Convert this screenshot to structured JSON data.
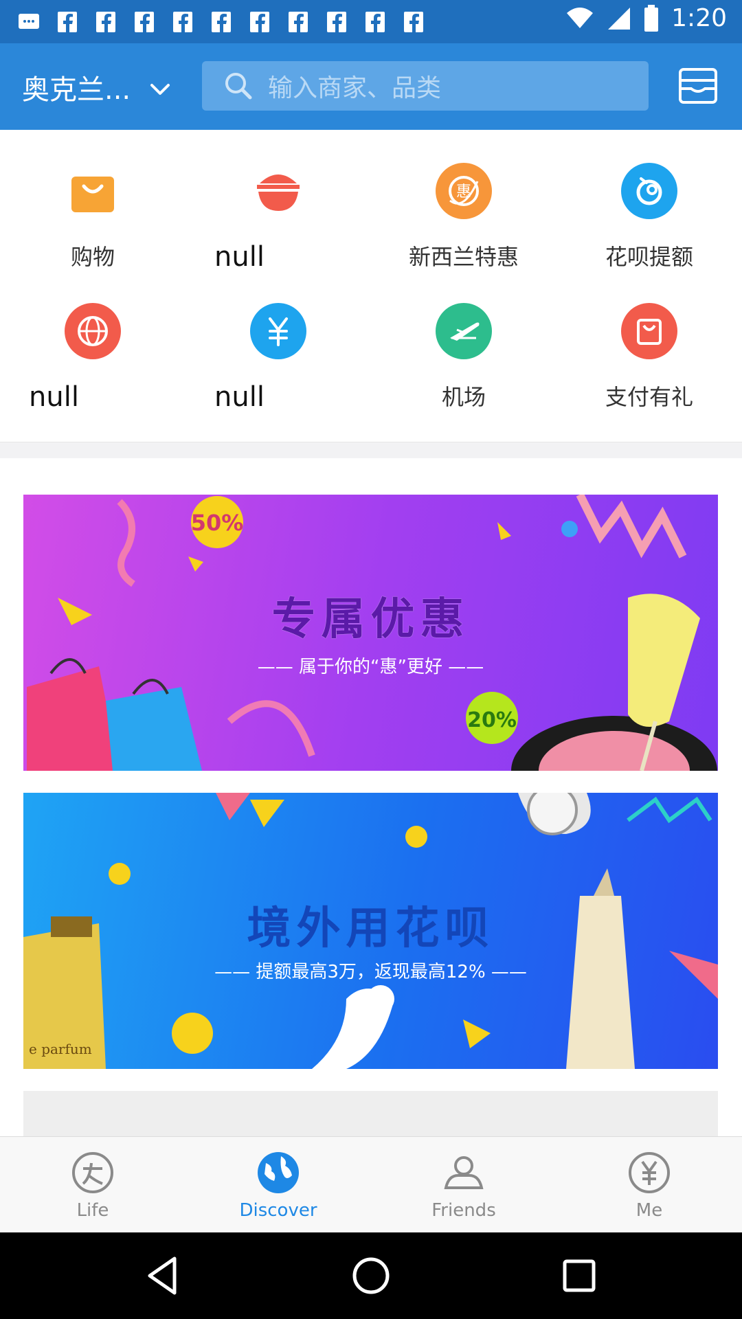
{
  "status_bar": {
    "time": "1:20",
    "notification_icons": [
      "message-icon",
      "facebook-icon",
      "facebook-icon",
      "facebook-icon",
      "facebook-icon",
      "facebook-icon",
      "facebook-icon",
      "facebook-icon",
      "facebook-icon",
      "facebook-icon",
      "facebook-icon"
    ]
  },
  "header": {
    "city": "奥克兰...",
    "search_placeholder": "输入商家、品类"
  },
  "grid": {
    "items": [
      {
        "label": "购物",
        "icon": "shopping-bag-icon",
        "color": "#f7a435"
      },
      {
        "label": "null",
        "icon": "food-bowl-icon",
        "color": "#f25b4b"
      },
      {
        "label": "新西兰特惠",
        "icon": "discount-icon",
        "color": "#f7963a"
      },
      {
        "label": "花呗提额",
        "icon": "huabei-icon",
        "color": "#1ea4ee"
      },
      {
        "label": "null",
        "icon": "globe-icon",
        "color": "#f25b4b"
      },
      {
        "label": "null",
        "icon": "yuan-icon",
        "color": "#1ea4ee"
      },
      {
        "label": "机场",
        "icon": "airplane-icon",
        "color": "#2dbd8d"
      },
      {
        "label": "支付有礼",
        "icon": "gift-icon",
        "color": "#f25b4b"
      }
    ]
  },
  "banners": [
    {
      "title": "专属优惠",
      "subtitle": "—— 属于你的“惠”更好 ——",
      "badges": [
        "50%",
        "20%"
      ]
    },
    {
      "title": "境外用花呗",
      "subtitle": "—— 提额最高3万，返现最高12% ——",
      "perfume_text": "e parfum"
    }
  ],
  "tabbar": {
    "tabs": [
      {
        "label": "Life",
        "icon": "life-icon"
      },
      {
        "label": "Discover",
        "icon": "discover-globe-icon"
      },
      {
        "label": "Friends",
        "icon": "friends-icon"
      },
      {
        "label": "Me",
        "icon": "yuan-circle-icon"
      }
    ],
    "active": "Discover"
  },
  "colors": {
    "header_blue": "#2b87d9",
    "status_blue": "#1f6fbd",
    "accent": "#1e88e5"
  }
}
